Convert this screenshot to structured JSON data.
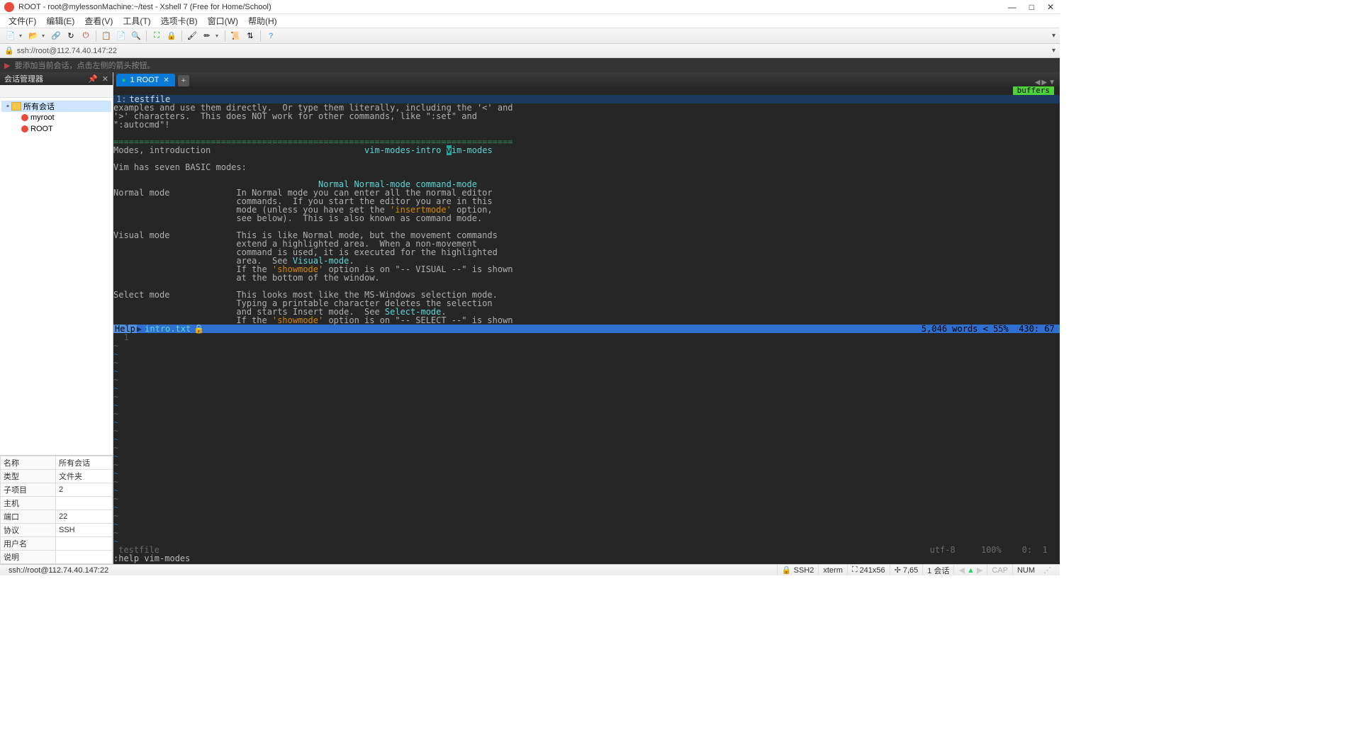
{
  "titlebar": {
    "title": "ROOT - root@mylessonMachine:~/test - Xshell 7 (Free for Home/School)"
  },
  "menubar": {
    "items": [
      "文件(F)",
      "编辑(E)",
      "查看(V)",
      "工具(T)",
      "选项卡(B)",
      "窗口(W)",
      "帮助(H)"
    ]
  },
  "addrbar": {
    "url": "ssh://root@112.74.40.147:22"
  },
  "hintbar": {
    "text": "要添加当前会话，点击左侧的箭头按钮。"
  },
  "sidebar": {
    "title": "会话管理器",
    "root": "所有会话",
    "items": [
      "myroot",
      "ROOT"
    ],
    "props": [
      {
        "k": "名称",
        "v": "所有会话"
      },
      {
        "k": "类型",
        "v": "文件夹"
      },
      {
        "k": "子项目",
        "v": "2"
      },
      {
        "k": "主机",
        "v": ""
      },
      {
        "k": "端口",
        "v": "22"
      },
      {
        "k": "协议",
        "v": "SSH"
      },
      {
        "k": "用户名",
        "v": ""
      },
      {
        "k": "说明",
        "v": ""
      }
    ]
  },
  "tabstrip": {
    "active": "1 ROOT"
  },
  "terminal": {
    "bufline_num": "1:",
    "bufline_name": "testfile",
    "buffers_tag": "buffers",
    "l1": "examples and use them directly.  Or type them literally, including the '<' and",
    "l2": "'>' characters.  This does NOT work for other commands, like \":set\" and",
    "l3": "\":autocmd\"!",
    "sep": "==============================================================================",
    "modes_intro": "Modes, introduction",
    "modes_link1": "vim-modes-intro",
    "modes_link2_first": "v",
    "modes_link2_rest": "im-modes",
    "l4": "Vim has seven BASIC modes:",
    "normal_links": "Normal Normal-mode command-mode",
    "nl1": "Normal mode             In Normal mode you can enter all the normal editor",
    "nl2": "                        commands.  If you start the editor you are in this",
    "nl3a": "                        mode (unless you have set the ",
    "nl3b": "'insertmode'",
    "nl3c": " option,",
    "nl4": "                        see below).  This is also known as command mode.",
    "vl1": "Visual mode             This is like Normal mode, but the movement commands",
    "vl2": "                        extend a highlighted area.  When a non-movement",
    "vl3": "                        command is used, it is executed for the highlighted",
    "vl4a": "                        area.  See ",
    "vl4b": "Visual-mode",
    "vl4c": ".",
    "vl5a": "                        If the ",
    "vl5b": "'showmode'",
    "vl5c": " option is on \"-- VISUAL --\" is shown",
    "vl6": "                        at the bottom of the window.",
    "sl1": "Select mode             This looks most like the MS-Windows selection mode.",
    "sl2": "                        Typing a printable character deletes the selection",
    "sl3a": "                        and starts Insert mode.  See ",
    "sl3b": "Select-mode",
    "sl3c": ".",
    "sl4a": "                        If the ",
    "sl4b": "'showmode'",
    "sl4c": " option is on \"-- SELECT --\" is shown",
    "help_label": "Help",
    "help_file": "intro.txt",
    "help_lock": "🔒",
    "help_right": " 5,046 words < 55%  430: 67 ",
    "gutter1": "  1 ",
    "tilde": "~",
    "status_file": " testfile",
    "status_right": "utf-8     100%    0:  1 ",
    "cmdline": ":help vim-modes"
  },
  "statusbar": {
    "left": "ssh://root@112.74.40.147:22",
    "ssh": "SSH2",
    "term": "xterm",
    "size": "241x56",
    "cursor": "7,65",
    "sess": "1 会话",
    "cap": "CAP",
    "num": "NUM"
  }
}
